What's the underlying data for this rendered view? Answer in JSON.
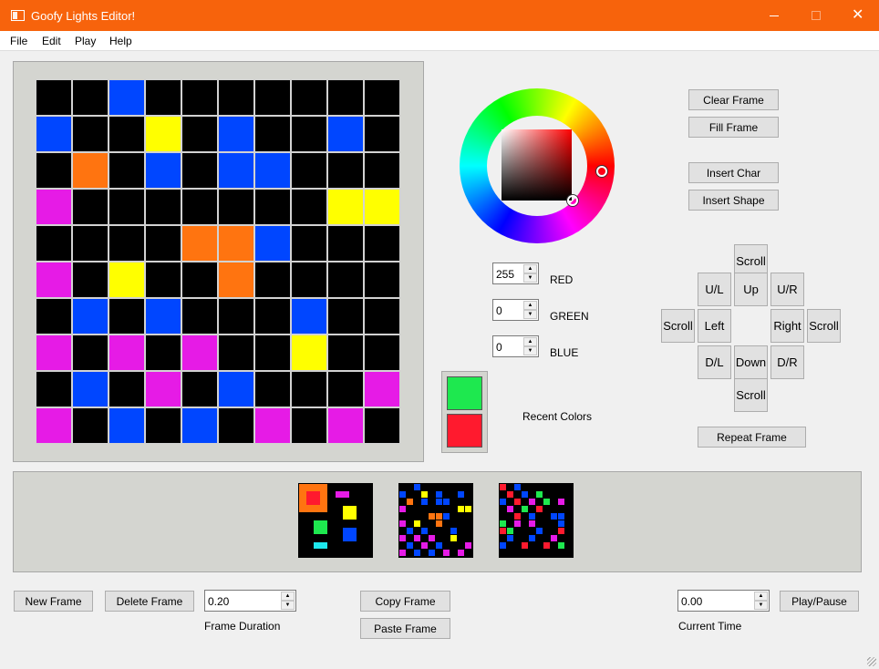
{
  "window": {
    "title": "Goofy Lights Editor!",
    "icon": "app-window-icon",
    "controls": {
      "minimize": "minimize-icon",
      "maximize": "maximize-icon",
      "close_glyph": "✕"
    }
  },
  "menu": {
    "items": [
      {
        "label": "File"
      },
      {
        "label": "Edit"
      },
      {
        "label": "Play"
      },
      {
        "label": "Help"
      }
    ]
  },
  "colors": {
    "K": "#000000",
    "B": "#0046ff",
    "Y": "#ffff00",
    "O": "#ff7410",
    "M": "#e61be6",
    "R": "#ff1a2e",
    "G": "#1ee84f",
    "C": "#1de8ee",
    "accent": "#f7630c"
  },
  "grid": {
    "rows": [
      "KKBKKKKKKK",
      "BKKYKBKKBK",
      "KOKBKBBKKK",
      "MKKKKKKKYY",
      "KKKKOOBKKK",
      "MKYKKOKKKK",
      "KBKBKKKBKK",
      "MKMKMKKYKK",
      "KBKMKBKKKM",
      "MKBKBKMKMK"
    ]
  },
  "color_picker": {
    "selected_hue": "red"
  },
  "rgb": {
    "red": {
      "value": "255",
      "label": "RED"
    },
    "green": {
      "value": "0",
      "label": "GREEN"
    },
    "blue": {
      "value": "0",
      "label": "BLUE"
    }
  },
  "recent_colors": {
    "label": "Recent Colors",
    "swatches": [
      "G",
      "R"
    ]
  },
  "actions": {
    "clear_frame": "Clear Frame",
    "fill_frame": "Fill Frame",
    "insert_char": "Insert Char",
    "insert_shape": "Insert Shape",
    "repeat_frame": "Repeat Frame"
  },
  "direction": {
    "scroll_top": "Scroll",
    "up_left": "U/L",
    "up": "Up",
    "up_right": "U/R",
    "scroll_left": "Scroll",
    "left": "Left",
    "right": "Right",
    "scroll_right": "Scroll",
    "down_left": "D/L",
    "down": "Down",
    "down_right": "D/R",
    "scroll_bottom": "Scroll"
  },
  "timeline": {
    "frames": [
      {
        "id": "frame-1",
        "pixels": [
          {
            "c": "O",
            "r": 0,
            "col": 0,
            "w": 4,
            "h": 4
          },
          {
            "c": "R",
            "r": 1,
            "col": 1,
            "w": 2,
            "h": 2
          },
          {
            "c": "M",
            "r": 1,
            "col": 5,
            "w": 2,
            "h": 1
          },
          {
            "c": "Y",
            "r": 3,
            "col": 6,
            "w": 2,
            "h": 2
          },
          {
            "c": "G",
            "r": 5,
            "col": 2,
            "w": 2,
            "h": 2
          },
          {
            "c": "B",
            "r": 6,
            "col": 6,
            "w": 2,
            "h": 2
          },
          {
            "c": "C",
            "r": 8,
            "col": 2,
            "w": 2,
            "h": 1
          }
        ]
      },
      {
        "id": "frame-2",
        "grid": [
          "KKBKKKKKKK",
          "BKKYKBKKBK",
          "KOKBKBBKKK",
          "MKKKKKKKYY",
          "KKKKOOBKKK",
          "MKYKKOKKKK",
          "KBKBKKKBKK",
          "MKMKMKKYKK",
          "KBKMKBKKKM",
          "MKBKBKMKMK"
        ]
      },
      {
        "id": "frame-3",
        "grid": [
          "RKBKKKKKKK",
          "KRKBKGKKKK",
          "BKRKMKGKMK",
          "KMKGKRKKKK",
          "KKRKBKKBBK",
          "GKMKMKKKBK",
          "RGKKKBKKRK",
          "KBKKBKKMKK",
          "BKKRKKRKGK",
          "KKKKKKKKKK"
        ]
      }
    ]
  },
  "bottom": {
    "new_frame": "New Frame",
    "delete_frame": "Delete Frame",
    "frame_duration": {
      "value": "0.20",
      "label": "Frame Duration"
    },
    "copy_frame": "Copy Frame",
    "paste_frame": "Paste Frame",
    "current_time": {
      "value": "0.00",
      "label": "Current Time"
    },
    "play_pause": "Play/Pause"
  }
}
